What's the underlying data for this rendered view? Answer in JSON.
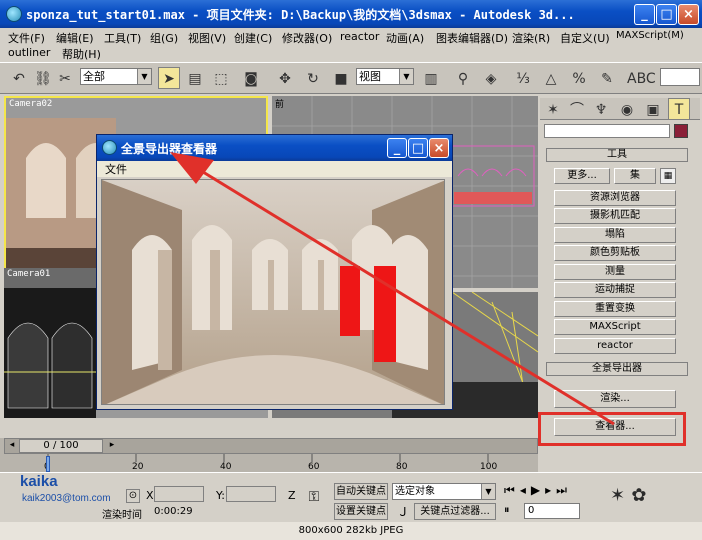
{
  "window": {
    "title": "sponza_tut_start01.max  -  项目文件夹: D:\\Backup\\我的文档\\3dsmax  -  Autodesk 3d...",
    "minimize": "_",
    "maximize": "□",
    "close": "×"
  },
  "menu": {
    "row1": [
      "文件(F)",
      "编辑(E)",
      "工具(T)",
      "组(G)",
      "视图(V)",
      "创建(C)",
      "修改器(O)",
      "reactor",
      "动画(A)",
      "图表编辑器(D)",
      "渲染(R)",
      "自定义(U)",
      "MAXScript(M)"
    ],
    "row2": [
      "outliner",
      "帮助(H)"
    ]
  },
  "toolbar": {
    "selection_filter": "全部",
    "ref_coord": "视图"
  },
  "viewports": {
    "top_left": "Camera02",
    "top_right": "前",
    "bottom_left": "Camera01"
  },
  "dialog": {
    "title": "全景导出器查看器",
    "menu_file": "文件"
  },
  "cmdpanel": {
    "tools_header": "工具",
    "more_button": "更多...",
    "set_button": "集",
    "buttons": [
      "资源浏览器",
      "摄影机匹配",
      "塌陷",
      "颜色剪贴板",
      "测量",
      "运动捕捉",
      "重置变换",
      "MAXScript",
      "reactor"
    ],
    "panorama_header": "全景导出器",
    "render_button": "渲染...",
    "viewer_button": "查看器..."
  },
  "timeline": {
    "frame_counter": "0 / 100",
    "ticks": [
      "0",
      "20",
      "40",
      "60",
      "80",
      "100"
    ]
  },
  "status": {
    "x_label": "X:",
    "y_label": "Y:",
    "z_label": "Z",
    "auto_key": "自动关键点",
    "selected_object": "选定对象",
    "set_key": "设置关键点",
    "key_filters": "关键点过滤器...",
    "render_time_label": "渲染时间",
    "render_time_value": "0:00:29",
    "frame_value": "0",
    "watermark_name": "kaika",
    "watermark_email": "kaik2003@tom.com"
  },
  "bottom_info": "800x600  282kb  JPEG",
  "colors": {
    "title_blue": "#0a4fc4",
    "highlight_red": "#e0302a",
    "panel_gray": "#d4d0c8"
  }
}
